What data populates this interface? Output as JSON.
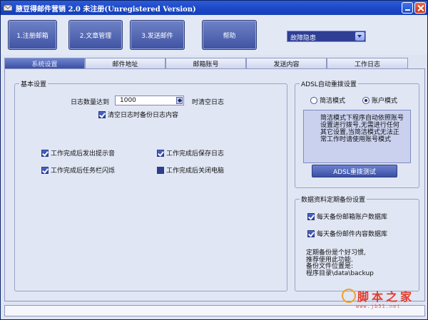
{
  "window": {
    "title": "腋豆得邮件营销 2.0 未注册(Unregistered Version)"
  },
  "toolbar": {
    "buttons": [
      "1.注册邮箱",
      "2.文章管理",
      "3.发送邮件",
      "帮助"
    ],
    "combo_value": "故障隐患"
  },
  "tabs": [
    "系统设置",
    "邮件地址",
    "邮箱账号",
    "发送内容",
    "工作日志"
  ],
  "basic": {
    "group_title": "基本设置",
    "log_count_label": "日志数量达到",
    "log_count_value": "1000",
    "log_count_suffix": "时清空日志",
    "backup_log_label": "清空日志时备份日志内容",
    "opt_sound": "工作完成后发出提示音",
    "opt_save_log": "工作完成后保存日志",
    "opt_taskbar_flash": "工作完成后任务栏闪烁",
    "opt_shutdown": "工作完成后关闭电脑"
  },
  "adsl": {
    "group_title": "ADSL自动重拨设置",
    "mode_simple": "简洁模式",
    "mode_account": "账户模式",
    "info_text": "简洁模式下程序自动依照账号设置进行拨号,无需进行任何其它设置,当简洁模式无法正常工作时请使用账号模式",
    "test_button": "ADSL重拨测试"
  },
  "backup": {
    "group_title": "数据资料定期备份设置",
    "opt_accounts": "每天备份邮箱账户数据库",
    "opt_content": "每天备份邮件内容数据库",
    "note_line1": "定期备份是个好习惯,",
    "note_line2": "推荐使用此功能.",
    "note_line3": "备份文件位置是:",
    "note_line4": "程序目录\\data\\backup"
  },
  "watermark": {
    "cn": "脚本之家",
    "url": "www.jb51.net"
  },
  "colors": {
    "title_bar": "#1a46c4",
    "active_tab": "#3b4fa2",
    "watermark": "#e23b2a"
  }
}
